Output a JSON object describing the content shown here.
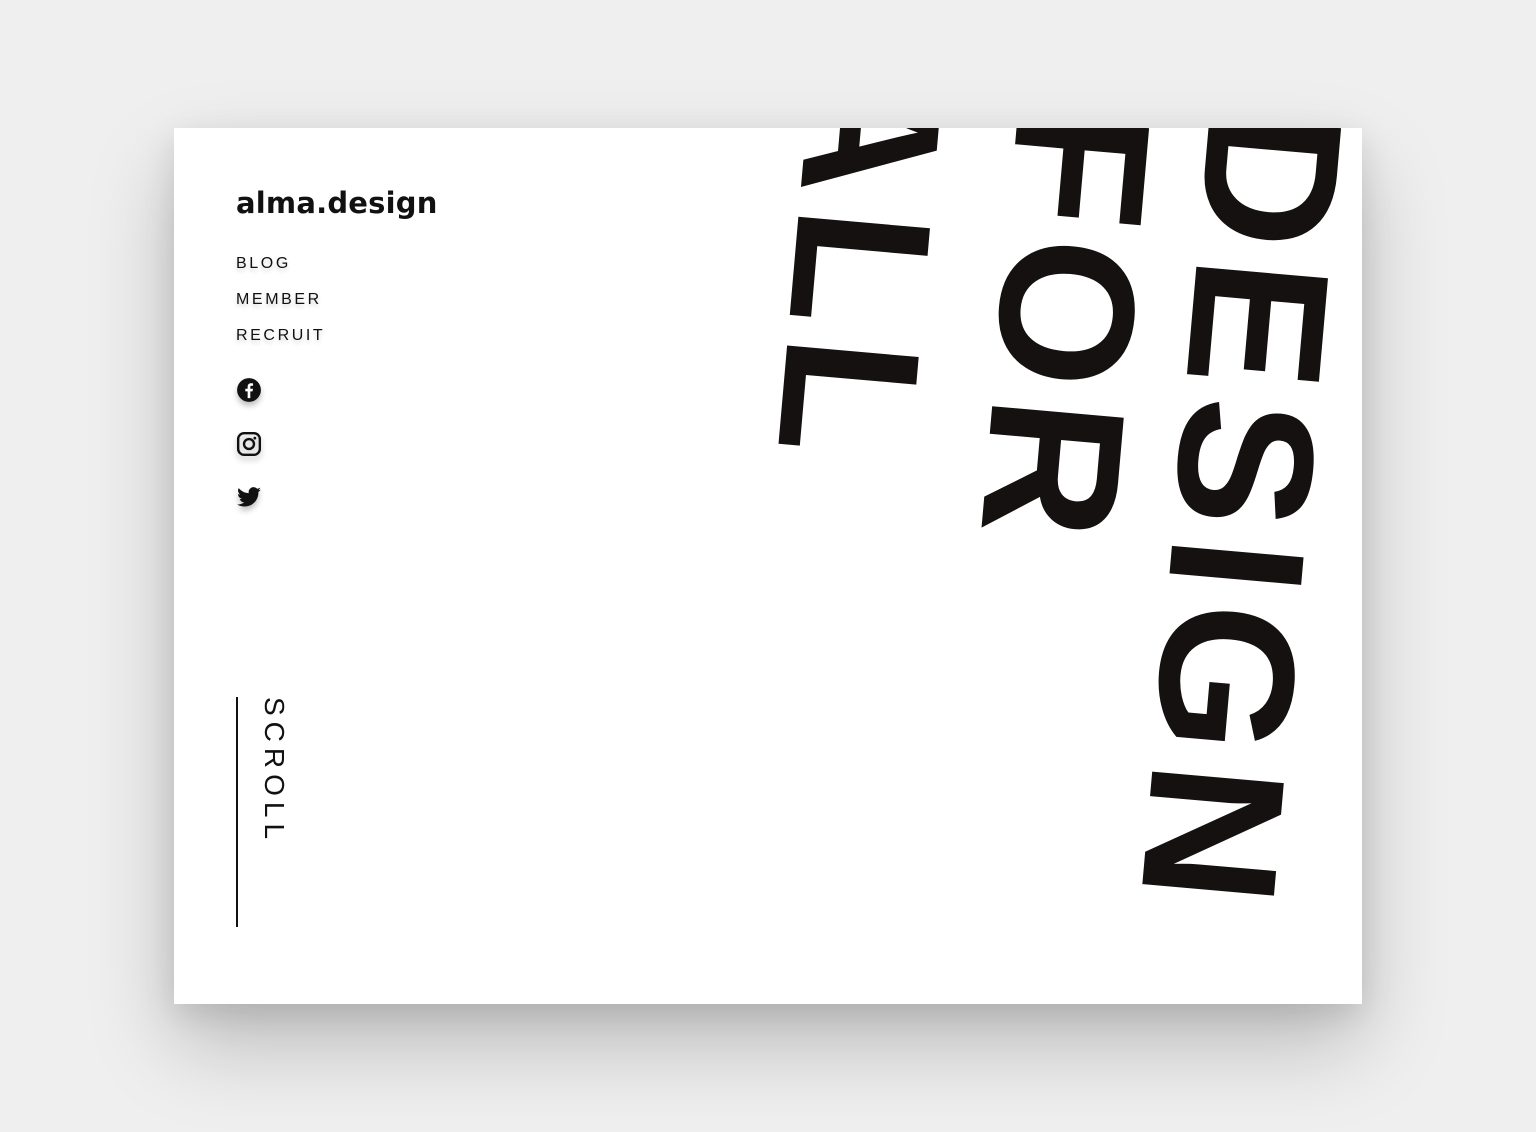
{
  "site": {
    "logo": "alma.design"
  },
  "nav": {
    "items": [
      {
        "label": "BLOG"
      },
      {
        "label": "MEMBER"
      },
      {
        "label": "RECRUIT"
      }
    ]
  },
  "social": [
    {
      "icon": "facebook-icon"
    },
    {
      "icon": "instagram-icon"
    },
    {
      "icon": "twitter-icon"
    }
  ],
  "hero": {
    "lines": [
      "DESIGN",
      "FOR",
      "ALL"
    ]
  },
  "scroll": {
    "label": "SCROLL"
  },
  "colors": {
    "background": "#efefef",
    "card": "#ffffff",
    "text": "#111111",
    "hero_text": "#141110"
  }
}
